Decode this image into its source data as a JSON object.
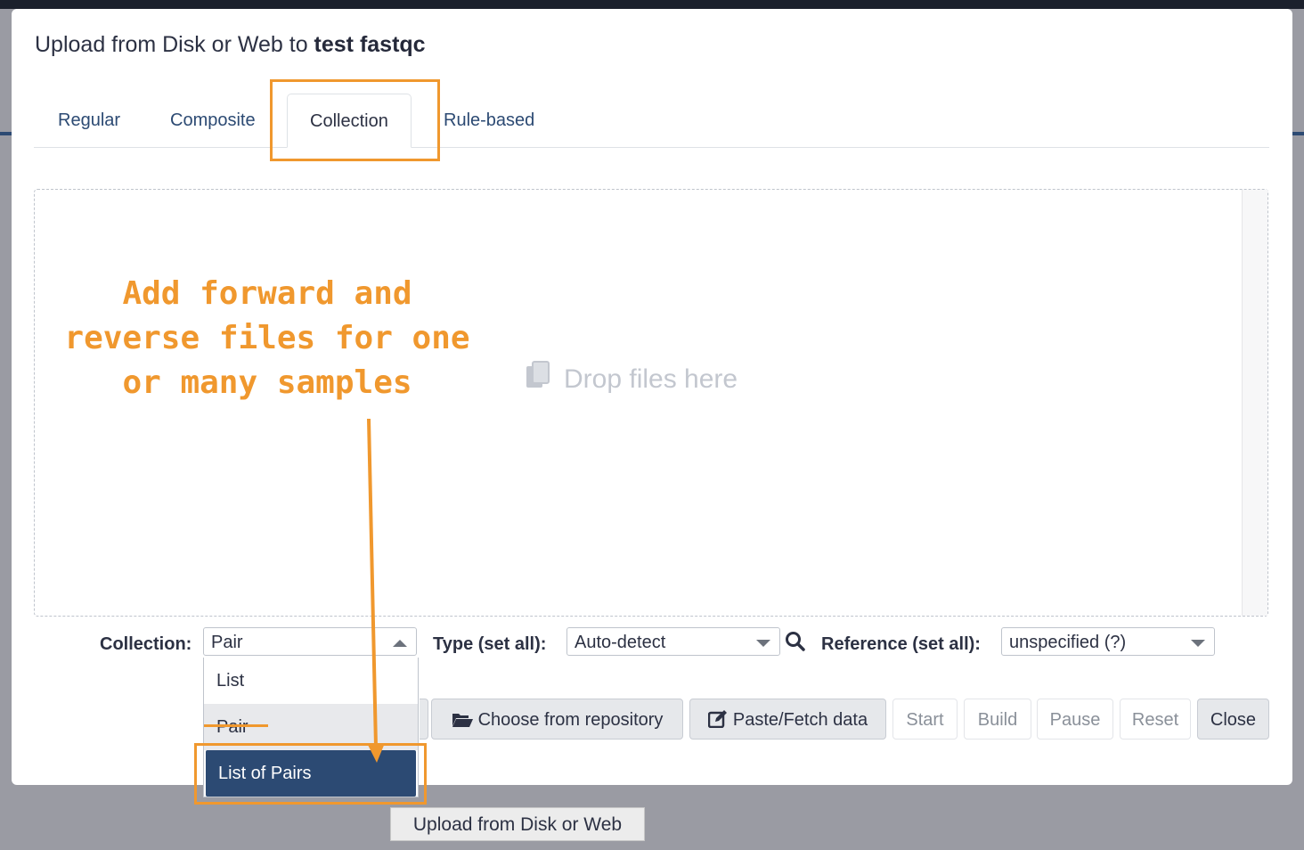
{
  "modal": {
    "title_prefix": "Upload from Disk or Web to ",
    "title_history": "test fastqc"
  },
  "tabs": [
    {
      "label": "Regular"
    },
    {
      "label": "Composite"
    },
    {
      "label": "Collection",
      "active": true
    },
    {
      "label": "Rule-based"
    }
  ],
  "dropzone": {
    "message": "Drop files here",
    "icon": "copy-files-icon"
  },
  "annotation": {
    "text": "Add forward and\nreverse files for one\nor many samples",
    "color": "#f0982e"
  },
  "form": {
    "collection_label": "Collection:",
    "collection_value": "Pair",
    "collection_options": [
      "List",
      "Pair",
      "List of Pairs"
    ],
    "highlighted_option": "List of Pairs",
    "type_label": "Type (set all):",
    "type_value": "Auto-detect",
    "reference_label": "Reference (set all):",
    "reference_value": "unspecified (?)"
  },
  "buttons": {
    "choose_repository": "Choose from repository",
    "paste_fetch": "Paste/Fetch data",
    "start": "Start",
    "build": "Build",
    "pause": "Pause",
    "reset": "Reset",
    "close": "Close"
  },
  "tooltip": {
    "text": "Upload from Disk or Web"
  },
  "colors": {
    "accent": "#2c4a73",
    "annotation": "#f0982e"
  }
}
